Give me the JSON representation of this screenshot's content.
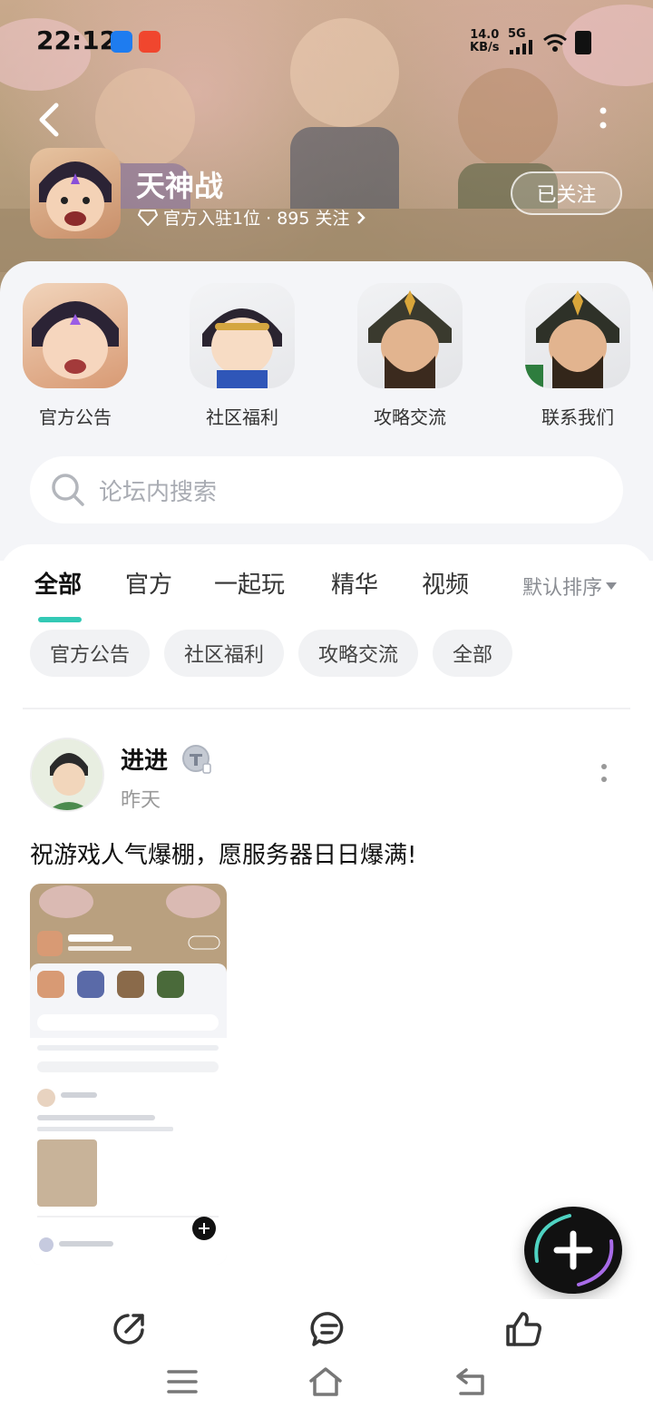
{
  "status_bar": {
    "time": "22:12",
    "net_speed_value": "14.0",
    "net_speed_unit": "KB/s",
    "network": "5G"
  },
  "header": {
    "game_title": "天神战",
    "meta": "官方入驻1位 · 895 关注",
    "follow_label": "已关注"
  },
  "categories": [
    {
      "label": "官方公告",
      "icon": "official-announcement-avatar"
    },
    {
      "label": "社区福利",
      "icon": "community-welfare-avatar"
    },
    {
      "label": "攻略交流",
      "icon": "guide-exchange-avatar"
    },
    {
      "label": "联系我们",
      "icon": "contact-us-avatar"
    }
  ],
  "search": {
    "placeholder": "论坛内搜索"
  },
  "tabs": [
    {
      "label": "全部",
      "active": true
    },
    {
      "label": "官方",
      "active": false
    },
    {
      "label": "一起玩",
      "active": false
    },
    {
      "label": "精华",
      "active": false
    },
    {
      "label": "视频",
      "active": false
    }
  ],
  "sort_label": "默认排序",
  "chips": [
    "官方公告",
    "社区福利",
    "攻略交流",
    "全部"
  ],
  "post": {
    "author": "进进",
    "time": "昨天",
    "text": "祝游戏人气爆棚，愿服务器日日爆满!"
  },
  "colors": {
    "accent": "#33c9b5",
    "hero_bg": "#b9a07f",
    "panel_bg": "#f4f5f8"
  }
}
